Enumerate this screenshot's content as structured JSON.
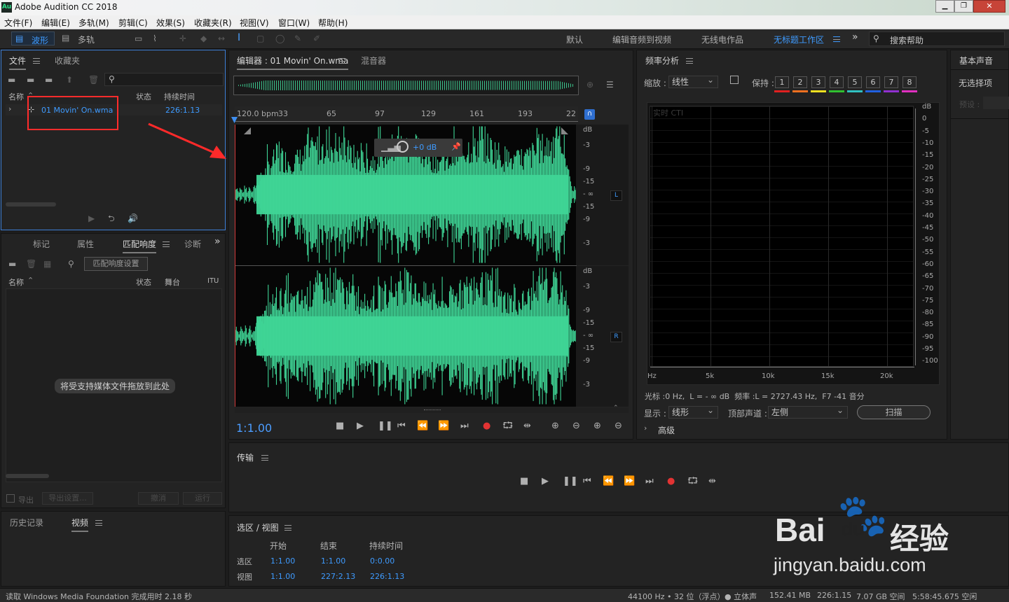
{
  "titlebar": {
    "app_icon": "Au",
    "title": "Adobe Audition CC 2018",
    "min": "▁",
    "max": "❐",
    "close": "✕"
  },
  "menu": [
    "文件(F)",
    "编辑(E)",
    "多轨(M)",
    "剪辑(C)",
    "效果(S)",
    "收藏夹(R)",
    "视图(V)",
    "窗口(W)",
    "帮助(H)"
  ],
  "toolbar": {
    "waveform_label": "波形",
    "multitrack_label": "多轨",
    "workspaces": [
      "默认",
      "编辑音频到视频",
      "无线电作品",
      "无标题工作区"
    ],
    "more": "»",
    "search_placeholder": "搜索帮助"
  },
  "files_panel": {
    "tabs": [
      "文件",
      "收藏夹"
    ],
    "columns": [
      "名称",
      "状态",
      "持续时间"
    ],
    "file": {
      "name": "01 Movin' On.wma",
      "duration": "226:1.13"
    }
  },
  "match_panel": {
    "tabs": [
      "标记",
      "属性",
      "匹配响度",
      "诊断"
    ],
    "settings_button": "匹配响度设置",
    "columns": [
      "名称",
      "状态",
      "舞台",
      "ITU"
    ],
    "drop_hint": "将受支持媒体文件拖放到此处",
    "export": "导出",
    "export_settings": "导出设置...",
    "undo": "撤消",
    "run": "运行"
  },
  "history_panel": {
    "tabs": [
      "历史记录",
      "视频"
    ]
  },
  "editor": {
    "tab_label": "编辑器 : 01 Movin' On.wma",
    "mixer_tab": "混音器",
    "bpm": "120.0 bpm",
    "ruler": [
      "33",
      "65",
      "97",
      "129",
      "161",
      "193",
      "22"
    ],
    "hud_gain": "+0 dB",
    "db_scale_top": [
      "dB",
      "-3",
      "-9",
      "-15",
      "- ∞",
      "-15",
      "-9",
      "-3"
    ],
    "db_scale_bottom": [
      "dB",
      "-3",
      "-9",
      "-15",
      "- ∞",
      "-15",
      "-9",
      "-3"
    ],
    "channel_left": "L",
    "channel_right": "R",
    "timecode": "1:1.00",
    "waveform_color": "#3fd596"
  },
  "freq_panel": {
    "title": "频率分析",
    "zoom_label": "缩放 :",
    "zoom_value": "线性",
    "hold_label": "保持 :",
    "holds": [
      "1",
      "2",
      "3",
      "4",
      "5",
      "6",
      "7",
      "8"
    ],
    "hold_colors": [
      "#e02020",
      "#f07020",
      "#f0e020",
      "#30c030",
      "#30c0c0",
      "#2060e0",
      "#9030d0",
      "#e030c0"
    ],
    "graph_label": "实时 CTI",
    "db_axis": [
      "dB",
      "0",
      "-5",
      "-10",
      "-15",
      "-20",
      "-25",
      "-30",
      "-35",
      "-40",
      "-45",
      "-50",
      "-55",
      "-60",
      "-65",
      "-70",
      "-75",
      "-80",
      "-85",
      "-90",
      "-95",
      "-100"
    ],
    "hz_axis": [
      "Hz",
      "5k",
      "10k",
      "15k",
      "20k"
    ],
    "cursor_info": "光标 :0 Hz,  L = - ∞ dB  频率 :L = 2727.43 Hz,  F7 -41 音分",
    "display_label": "显示 :",
    "display_value": "线形",
    "channel_label": "顶部声道 :",
    "channel_value": "左侧",
    "scan_button": "扫描",
    "advanced": "高级"
  },
  "essential_panel": {
    "title": "基本声音",
    "no_selection": "无选择项",
    "preset": "预设 :"
  },
  "transport_panel": {
    "title": "传输"
  },
  "selection_panel": {
    "title": "选区 / 视图",
    "columns": [
      "开始",
      "结束",
      "持续时间"
    ],
    "rows": [
      {
        "label": "选区",
        "start": "1:1.00",
        "end": "1:1.00",
        "duration": "0:0.00"
      },
      {
        "label": "视图",
        "start": "1:1.00",
        "end": "227:2.13",
        "duration": "226:1.13"
      }
    ]
  },
  "statusbar": {
    "message": "读取 Windows Media Foundation 完成用时 2.18 秒",
    "items": [
      "44100 Hz • 32 位（浮点）",
      "● 立体声",
      "152.41 MB",
      "226:1.15",
      "7.07 GB 空间",
      "5:58:45.675 空闲"
    ]
  },
  "watermark": {
    "brand": "Bai",
    "brand2": "du",
    "jingyan": "经验",
    "url": "jingyan.baidu.com"
  }
}
